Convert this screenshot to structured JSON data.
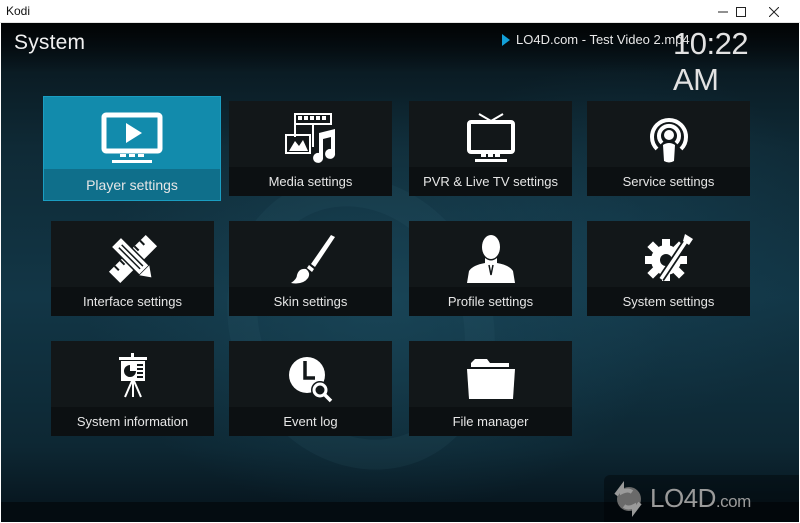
{
  "window": {
    "title": "Kodi",
    "controls": {
      "minimize": "—",
      "maximize": "☐",
      "close": "✕"
    }
  },
  "header": {
    "title": "System",
    "now_playing": "LO4D.com - Test Video 2.mp4",
    "clock": "10:22 AM"
  },
  "tiles": [
    {
      "label": "Player settings",
      "icon": "monitor-play-icon",
      "focused": true
    },
    {
      "label": "Media settings",
      "icon": "media-icon",
      "focused": false
    },
    {
      "label": "PVR & Live TV settings",
      "icon": "tv-antenna-icon",
      "focused": false
    },
    {
      "label": "Service settings",
      "icon": "podcast-broadcast-icon",
      "focused": false
    },
    {
      "label": "Interface settings",
      "icon": "pencil-ruler-icon",
      "focused": false
    },
    {
      "label": "Skin settings",
      "icon": "paintbrush-icon",
      "focused": false
    },
    {
      "label": "Profile settings",
      "icon": "user-profile-icon",
      "focused": false
    },
    {
      "label": "System settings",
      "icon": "gear-wrench-icon",
      "focused": false
    },
    {
      "label": "System information",
      "icon": "presentation-board-icon",
      "focused": false
    },
    {
      "label": "Event log",
      "icon": "clock-search-icon",
      "focused": false
    },
    {
      "label": "File manager",
      "icon": "folder-icon",
      "focused": false
    }
  ],
  "colors": {
    "focus_accent": "#128bac",
    "tile_bg": "#121719",
    "play_indicator": "#12a0d8"
  },
  "watermark": {
    "brand": "LO4D",
    "suffix": ".com"
  }
}
